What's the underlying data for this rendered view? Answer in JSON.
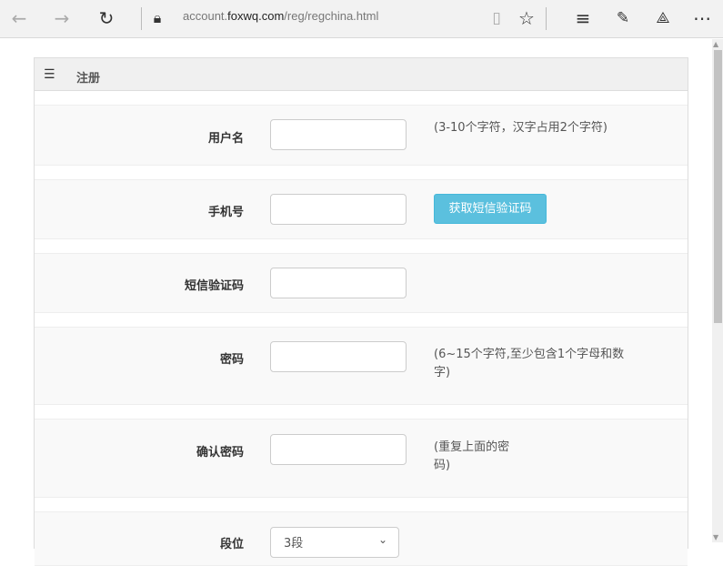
{
  "browser": {
    "url_prefix": "account.",
    "url_domain": "foxwq.com",
    "url_path": "/reg/regchina.html"
  },
  "panel": {
    "title": "注册"
  },
  "form": {
    "username": {
      "label": "用户名",
      "hint": "(3-10个字符，汉字占用2个字符)"
    },
    "phone": {
      "label": "手机号",
      "button": "获取短信验证码"
    },
    "sms_code": {
      "label": "短信验证码"
    },
    "password": {
      "label": "密码",
      "hint": "(6~15个字符,至少包含1个字母和数字)"
    },
    "confirm": {
      "label": "确认密码",
      "hint": "(重复上面的密码)"
    },
    "rank": {
      "label": "段位",
      "value": "3段"
    }
  }
}
